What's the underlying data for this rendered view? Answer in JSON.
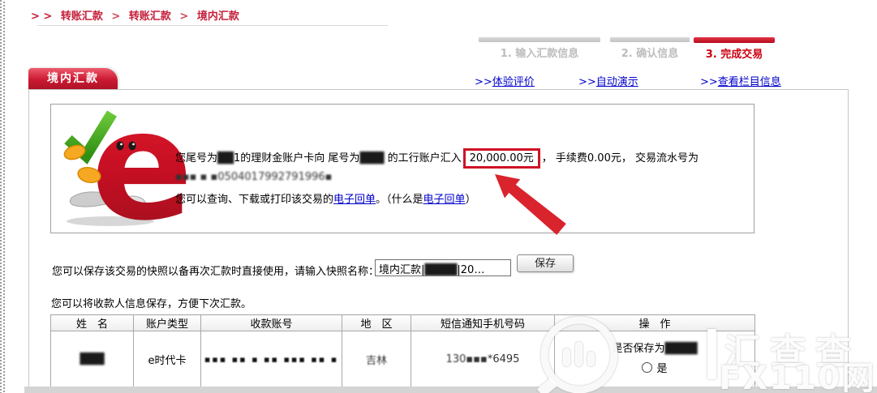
{
  "breadcrumb": {
    "arrows": "> >",
    "sep": ">",
    "items": [
      "转账汇款",
      "转账汇款",
      "境内汇款"
    ]
  },
  "steps": {
    "items": [
      {
        "label": "1. 输入汇款信息"
      },
      {
        "label": "2. 确认信息"
      },
      {
        "label": "3. 完成交易"
      }
    ]
  },
  "tab": {
    "label": "境内汇款"
  },
  "quick_links": {
    "prefix": ">>",
    "items": [
      {
        "label": "体验评价"
      },
      {
        "label": "自动演示"
      },
      {
        "label": "查看栏目信息"
      }
    ]
  },
  "result": {
    "seg1": "您尾号为",
    "mask_from": "██",
    "from_tail": "1",
    "seg2": "的理财金账户卡向 尾号为",
    "mask_to": "███",
    "seg3": "的工行账户汇入",
    "amount": "20,000.00元",
    "seg4": "， 手续费",
    "fee": "0.00元",
    "seg5": "， 交易流水号为",
    "mask_serial": "▪▪▪ ▪ ▪0504017992791996▪",
    "receipt": {
      "t1": "您可以查询、下载或打印该交易的",
      "link1": "电子回单",
      "t2": "。（什么是",
      "link2": "电子回单",
      "t3": "）"
    }
  },
  "snapshot": {
    "label": "您可以保存该交易的快照以备再次汇款时直接使用，请输入快照名称：",
    "value_prefix": "境内汇款|",
    "value_masked": "████",
    "value_suffix": "|20…",
    "save": "保存"
  },
  "recipient": {
    "note": "您可以将收款人信息保存，方便下次汇款。",
    "headers": [
      "姓　名",
      "账户类型",
      "收款账号",
      "地　区",
      "短信通知手机号码",
      "操　作"
    ],
    "row": {
      "name": "███",
      "account_type": "e时代卡",
      "account_number": "▪▪▪ ▪▪ ▪ ▪▪ ▪▪▪ ▪▪ ▪",
      "region": "吉林",
      "phone_masked": "130▪▪▪",
      "phone_tail": "*6495",
      "save_q": "是否保存为",
      "save_q_mask": "████",
      "yes": "是"
    }
  },
  "watermark": {
    "cn": "汇查查",
    "en": "FX110网"
  },
  "colors": {
    "brand_red": "#c5203a",
    "active_step_red": "#cc0011",
    "link_blue": "#0000cc",
    "highlight_box_red": "#cf1225",
    "tab_red": "#cb1a33"
  }
}
